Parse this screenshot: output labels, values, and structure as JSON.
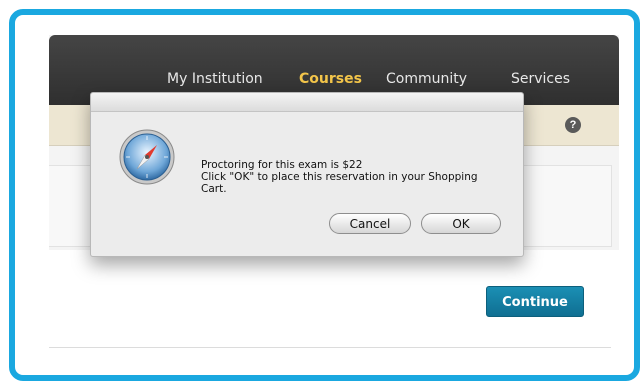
{
  "nav": {
    "items": [
      {
        "label": "My Institution"
      },
      {
        "label": "Courses"
      },
      {
        "label": "Community"
      },
      {
        "label": "Services"
      }
    ],
    "active": "Courses"
  },
  "help": {
    "label": "?"
  },
  "dialog": {
    "icon": "safari-compass-icon",
    "lines": [
      "Proctoring for this exam is $22",
      "Click \"OK\" to place this reservation in your Shopping",
      "Cart."
    ],
    "cancel_label": "Cancel",
    "ok_label": "OK"
  },
  "page": {
    "continue_label": "Continue"
  },
  "colors": {
    "frame": "#1aa8e0",
    "nav_bg": "#3a3a3a",
    "nav_active": "#f3c54a",
    "continue": "#127ea3"
  }
}
